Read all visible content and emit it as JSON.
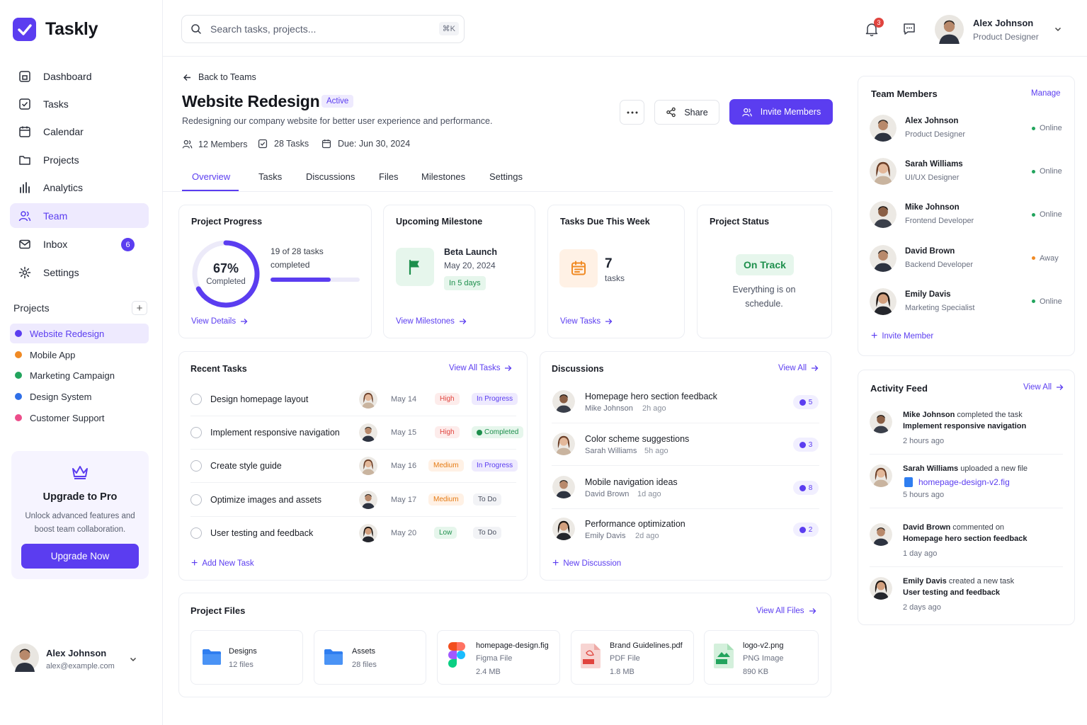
{
  "app": {
    "name": "Taskly"
  },
  "nav": [
    {
      "label": "Dashboard"
    },
    {
      "label": "Tasks"
    },
    {
      "label": "Calendar"
    },
    {
      "label": "Projects"
    },
    {
      "label": "Analytics"
    },
    {
      "label": "Team"
    },
    {
      "label": "Inbox",
      "badge": "6"
    },
    {
      "label": "Settings"
    }
  ],
  "projects": {
    "heading": "Projects",
    "add": "+",
    "items": [
      {
        "label": "Website Redesign",
        "color": "#5b3df0"
      },
      {
        "label": "Mobile App",
        "color": "#f08a24"
      },
      {
        "label": "Marketing Campaign",
        "color": "#22a45d"
      },
      {
        "label": "Design System",
        "color": "#2f6fe8"
      },
      {
        "label": "Customer Support",
        "color": "#ec4d8a"
      }
    ]
  },
  "upgrade": {
    "title": "Upgrade to Pro",
    "text": "Unlock advanced features and boost team collaboration.",
    "button": "Upgrade Now"
  },
  "sidebar_user": {
    "name": "Alex Johnson",
    "email": "alex@example.com"
  },
  "search": {
    "placeholder": "Search tasks, projects...",
    "shortcut": "⌘K"
  },
  "header": {
    "notifications": "3",
    "user_name": "Alex Johnson",
    "user_role": "Product Designer"
  },
  "project": {
    "back": "Back to Teams",
    "title": "Website Redesign",
    "status": "Active",
    "description": "Redesigning our company website for better user experience and performance.",
    "members": "12 Members",
    "tasks": "28 Tasks",
    "due": "Due: Jun 30, 2024",
    "share": "Share",
    "invite": "Invite Members"
  },
  "tabs": [
    "Overview",
    "Tasks",
    "Discussions",
    "Files",
    "Milestones",
    "Settings"
  ],
  "progress": {
    "title": "Project Progress",
    "percent": "67%",
    "percent_value": 0.67,
    "caption": "Completed",
    "summary": "19 of 28 tasks completed",
    "bar_value": 0.678,
    "link": "View Details"
  },
  "milestone": {
    "title": "Upcoming Milestone",
    "name": "Beta Launch",
    "date": "May 20, 2024",
    "badge": "In 5 days",
    "link": "View Milestones"
  },
  "due_week": {
    "title": "Tasks Due This Week",
    "count": "7",
    "unit": "tasks",
    "link": "View Tasks"
  },
  "status": {
    "title": "Project Status",
    "badge": "On Track",
    "text": "Everything is on schedule."
  },
  "recent_tasks": {
    "title": "Recent Tasks",
    "link": "View All Tasks",
    "add": "Add New Task",
    "rows": [
      {
        "name": "Design homepage layout",
        "date": "May 14",
        "priority": "High",
        "status": "In Progress",
        "avatar": "f"
      },
      {
        "name": "Implement responsive navigation",
        "date": "May 15",
        "priority": "High",
        "status": "Completed",
        "avatar": "m"
      },
      {
        "name": "Create style guide",
        "date": "May 16",
        "priority": "Medium",
        "status": "In Progress",
        "avatar": "f"
      },
      {
        "name": "Optimize images and assets",
        "date": "May 17",
        "priority": "Medium",
        "status": "To Do",
        "avatar": "m"
      },
      {
        "name": "User testing and feedback",
        "date": "May 20",
        "priority": "Low",
        "status": "To Do",
        "avatar": "f2"
      }
    ]
  },
  "discussions": {
    "title": "Discussions",
    "link": "View All",
    "add": "New Discussion",
    "rows": [
      {
        "title": "Homepage hero section feedback",
        "author": "Mike Johnson",
        "time": "2h ago",
        "count": "5",
        "avatar": "m2"
      },
      {
        "title": "Color scheme suggestions",
        "author": "Sarah Williams",
        "time": "5h ago",
        "count": "3",
        "avatar": "f"
      },
      {
        "title": "Mobile navigation ideas",
        "author": "David Brown",
        "time": "1d ago",
        "count": "8",
        "avatar": "m"
      },
      {
        "title": "Performance optimization",
        "author": "Emily Davis",
        "time": "2d ago",
        "count": "2",
        "avatar": "f2"
      }
    ]
  },
  "files": {
    "title": "Project Files",
    "link": "View All Files",
    "items": [
      {
        "name": "Designs",
        "meta": "12 files"
      },
      {
        "name": "Assets",
        "meta": "28 files"
      },
      {
        "name": "homepage-design.fig",
        "type": "Figma File",
        "size": "2.4 MB"
      },
      {
        "name": "Brand Guidelines.pdf",
        "type": "PDF File",
        "size": "1.8 MB"
      },
      {
        "name": "logo-v2.png",
        "type": "PNG Image",
        "size": "890 KB"
      }
    ]
  },
  "team": {
    "title": "Team Members",
    "manage": "Manage",
    "invite": "Invite Member",
    "members": [
      {
        "name": "Alex Johnson",
        "role": "Product Designer",
        "status": "Online",
        "status_color": "#22a45d",
        "avatar": "m"
      },
      {
        "name": "Sarah Williams",
        "role": "UI/UX Designer",
        "status": "Online",
        "status_color": "#22a45d",
        "avatar": "f"
      },
      {
        "name": "Mike Johnson",
        "role": "Frontend Developer",
        "status": "Online",
        "status_color": "#22a45d",
        "avatar": "m2"
      },
      {
        "name": "David Brown",
        "role": "Backend Developer",
        "status": "Away",
        "status_color": "#f08a24",
        "avatar": "m"
      },
      {
        "name": "Emily Davis",
        "role": "Marketing Specialist",
        "status": "Online",
        "status_color": "#22a45d",
        "avatar": "f2"
      }
    ]
  },
  "activity": {
    "title": "Activity Feed",
    "link": "View All",
    "items": [
      {
        "actor": "Mike Johnson",
        "action": " completed the task",
        "target": "Implement responsive navigation",
        "time": "2 hours ago",
        "avatar": "m2"
      },
      {
        "actor": "Sarah Williams",
        "action": " uploaded a new file",
        "target": "homepage-design-v2.fig",
        "time": "5 hours ago",
        "avatar": "f"
      },
      {
        "actor": "David Brown",
        "action": " commented on",
        "target": "Homepage hero section feedback",
        "time": "1 day ago",
        "avatar": "m"
      },
      {
        "actor": "Emily Davis",
        "action": " created a new task",
        "target": "User testing and feedback",
        "time": "2 days ago",
        "avatar": "f2"
      }
    ]
  },
  "colors": {
    "accent": "#5b3df0",
    "success": "#22a45d",
    "warning": "#f08a24",
    "danger": "#e0443e"
  }
}
